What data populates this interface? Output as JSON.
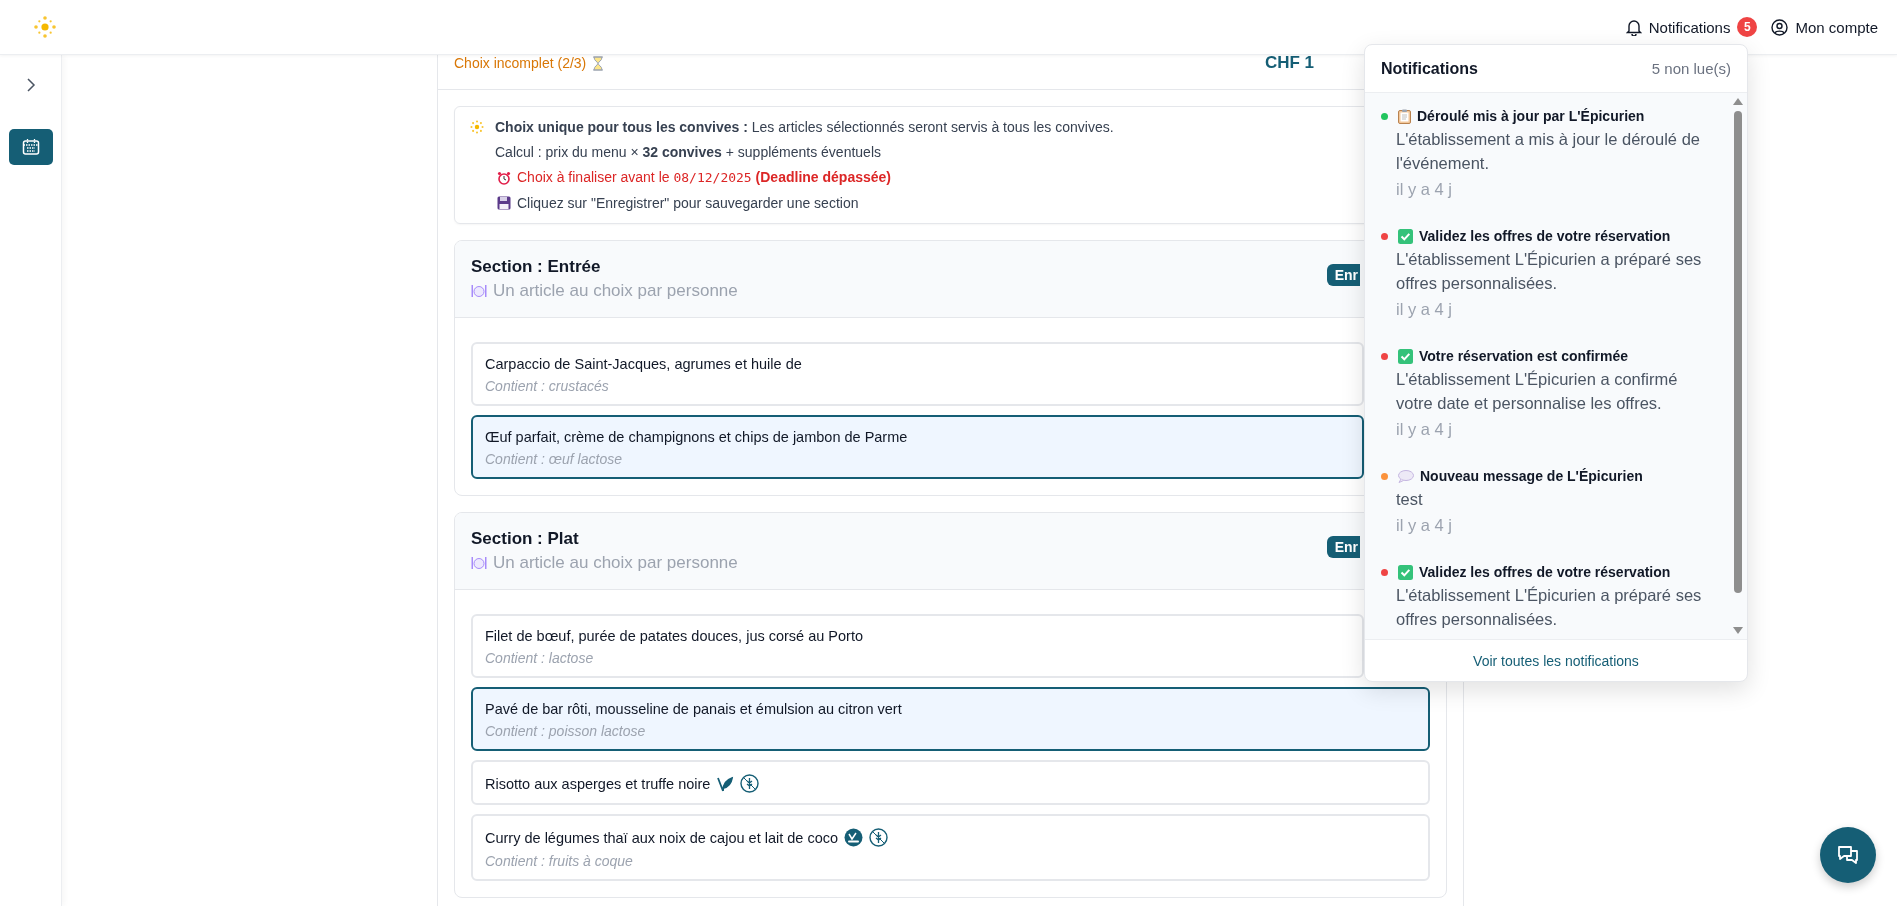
{
  "header": {
    "notifications_label": "Notifications",
    "notifications_count": "5",
    "account_label": "Mon compte"
  },
  "sidebar": {
    "items": [
      {
        "kind": "expand",
        "selected": false
      },
      {
        "kind": "calendar",
        "selected": true
      }
    ]
  },
  "summary": {
    "status": "Choix incomplet (2/3)",
    "price": "CHF 1"
  },
  "info": {
    "lines": [
      {
        "kind": "headline",
        "text": "**Choix unique pour tous les convives :** Les articles sélectionnés seront servis à tous les convives."
      },
      {
        "kind": "plain",
        "text": "Calcul : prix du menu × **32 convives** + suppléments éventuels"
      },
      {
        "kind": "deadline",
        "text": "Choix à finaliser avant le",
        "date": "08/12/2025",
        "warning": "(Deadline dépassée)"
      },
      {
        "kind": "save",
        "text": "Cliquez sur \"Enregistrer\" pour sauvegarder une section"
      }
    ]
  },
  "sections": [
    {
      "title": "Section : Entrée",
      "subtitle": "Un article au choix par personne",
      "save_label": "Enr",
      "items": [
        {
          "name": "Carpaccio de Saint-Jacques, agrumes et huile de",
          "allergens": "Contient : crustacés",
          "selected": false
        },
        {
          "name": "Œuf parfait, crème de champignons et chips de jambon de Parme",
          "allergens": "Contient : œuf lactose",
          "selected": true
        }
      ]
    },
    {
      "title": "Section : Plat",
      "subtitle": "Un article au choix par personne",
      "save_label": "Enr",
      "items": [
        {
          "name": "Filet de bœuf, purée de patates douces, jus corsé au Porto",
          "allergens": "Contient : lactose",
          "selected": false
        },
        {
          "name": "Pavé de bar rôti, mousseline de panais et émulsion au citron vert",
          "allergens": "Contient : poisson lactose",
          "selected": true
        },
        {
          "name": "Risotto aux asperges et truffe noire",
          "selected": false,
          "badges": [
            {
              "kind": "leaf"
            },
            {
              "kind": "gluten-free"
            }
          ]
        },
        {
          "name": "Curry de légumes thaï aux noix de cajou et lait de coco",
          "allergens": "Contient : fruits à coque",
          "selected": false,
          "badges": [
            {
              "kind": "vegan"
            },
            {
              "kind": "gluten-free"
            }
          ]
        }
      ]
    }
  ],
  "notifications": {
    "title": "Notifications",
    "unread": "5 non lue(s)",
    "footer": "Voir toutes les notifications",
    "items": [
      {
        "kind": "clipboard",
        "color": "#22c55e",
        "title": "Déroulé mis à jour par L'Épicurien",
        "body": "L'établissement a mis à jour le déroulé de l'événement.",
        "time": "il y a 4 j"
      },
      {
        "kind": "check",
        "color": "#ef4444",
        "title": "Validez les offres de votre réservation",
        "body": "L'établissement L'Épicurien a préparé ses offres personnalisées.",
        "time": "il y a 4 j"
      },
      {
        "kind": "check",
        "color": "#ef4444",
        "title": "Votre réservation est confirmée",
        "body": "L'établissement L'Épicurien a confirmé votre date et personnalise les offres.",
        "time": "il y a 4 j"
      },
      {
        "kind": "speech",
        "color": "#fb923c",
        "title": "Nouveau message de L'Épicurien",
        "body": "test",
        "time": "il y a 4 j"
      },
      {
        "kind": "check",
        "color": "#ef4444",
        "title": "Validez les offres de votre réservation",
        "body": "L'établissement L'Épicurien a préparé ses offres personnalisées."
      }
    ]
  }
}
